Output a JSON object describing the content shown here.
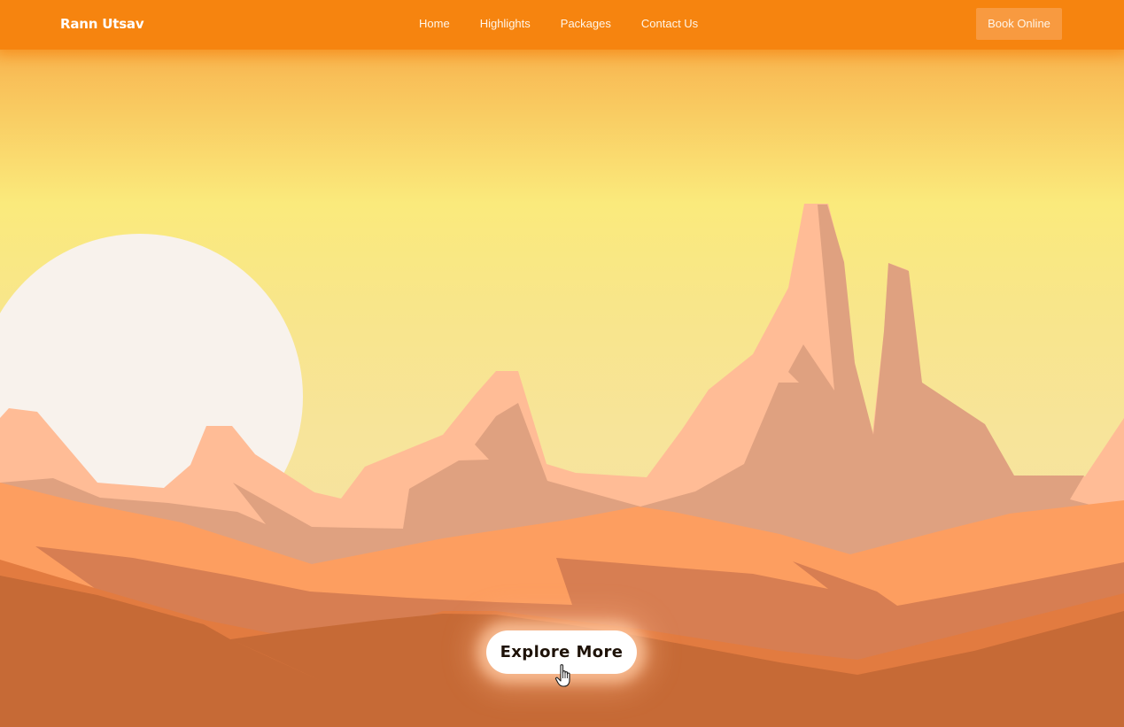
{
  "nav": {
    "brand": "Rann Utsav",
    "links": [
      {
        "label": "Home"
      },
      {
        "label": "Highlights"
      },
      {
        "label": "Packages"
      },
      {
        "label": "Contact Us"
      }
    ],
    "cta_label": "Book Online"
  },
  "hero": {
    "cta_label": "Explore More",
    "background": "desert-sunset-illustration"
  },
  "icons": {
    "cursor": "hand-pointer-icon",
    "sun": "sun-icon"
  },
  "colors": {
    "nav_bg": "#f6840f",
    "book_btn_bg": "#f89a40",
    "sky_top": "#f7a443",
    "sky_mid": "#faea7c",
    "sun": "#f8f2ec",
    "mesa_light": "#ffbc96",
    "mesa_shadow": "#dfa180",
    "dune_orange": "#fd9e60",
    "dune_shadow": "#d77e52",
    "dune_edge": "#e27b40",
    "ground": "#c66a36",
    "explore_btn_bg": "#ffffff"
  }
}
